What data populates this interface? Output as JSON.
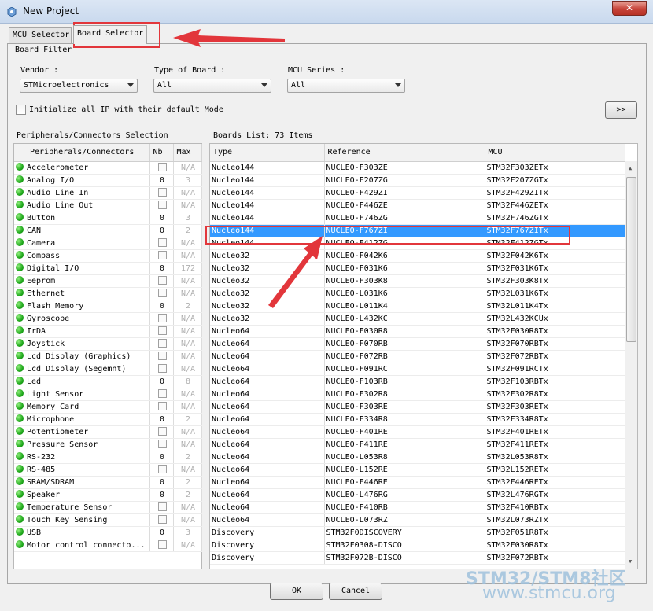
{
  "window": {
    "title": "New Project",
    "close_glyph": "✕"
  },
  "tabs": [
    {
      "label": "MCU Selector"
    },
    {
      "label": "Board Selector"
    }
  ],
  "board_filter": {
    "title": "Board Filter",
    "vendor_label": "Vendor :",
    "vendor_value": "STMicroelectronics",
    "type_label": "Type of Board :",
    "type_value": "All",
    "series_label": "MCU Series :",
    "series_value": "All",
    "init_ip_label": "Initialize all IP with their default Mode",
    "expand_label": ">>"
  },
  "peripherals": {
    "title": "Peripherals/Connectors Selection",
    "headers": [
      "Peripherals/Connectors",
      "Nb",
      "Max"
    ],
    "rows": [
      {
        "name": "Accelerometer",
        "nb": "",
        "max": "N/A"
      },
      {
        "name": "Analog I/O",
        "nb": "0",
        "max": "3"
      },
      {
        "name": "Audio Line In",
        "nb": "",
        "max": "N/A"
      },
      {
        "name": "Audio Line Out",
        "nb": "",
        "max": "N/A"
      },
      {
        "name": "Button",
        "nb": "0",
        "max": "3"
      },
      {
        "name": "CAN",
        "nb": "0",
        "max": "2"
      },
      {
        "name": "Camera",
        "nb": "",
        "max": "N/A"
      },
      {
        "name": "Compass",
        "nb": "",
        "max": "N/A"
      },
      {
        "name": "Digital I/O",
        "nb": "0",
        "max": "172"
      },
      {
        "name": "Eeprom",
        "nb": "",
        "max": "N/A"
      },
      {
        "name": "Ethernet",
        "nb": "",
        "max": "N/A"
      },
      {
        "name": "Flash Memory",
        "nb": "0",
        "max": "2"
      },
      {
        "name": "Gyroscope",
        "nb": "",
        "max": "N/A"
      },
      {
        "name": "IrDA",
        "nb": "",
        "max": "N/A"
      },
      {
        "name": "Joystick",
        "nb": "",
        "max": "N/A"
      },
      {
        "name": "Lcd Display (Graphics)",
        "nb": "",
        "max": "N/A"
      },
      {
        "name": "Lcd Display (Segemnt)",
        "nb": "",
        "max": "N/A"
      },
      {
        "name": "Led",
        "nb": "0",
        "max": "8"
      },
      {
        "name": "Light Sensor",
        "nb": "",
        "max": "N/A"
      },
      {
        "name": "Memory Card",
        "nb": "",
        "max": "N/A"
      },
      {
        "name": "Microphone",
        "nb": "0",
        "max": "2"
      },
      {
        "name": "Potentiometer",
        "nb": "",
        "max": "N/A"
      },
      {
        "name": "Pressure Sensor",
        "nb": "",
        "max": "N/A"
      },
      {
        "name": "RS-232",
        "nb": "0",
        "max": "2"
      },
      {
        "name": "RS-485",
        "nb": "",
        "max": "N/A"
      },
      {
        "name": "SRAM/SDRAM",
        "nb": "0",
        "max": "2"
      },
      {
        "name": "Speaker",
        "nb": "0",
        "max": "2"
      },
      {
        "name": "Temperature Sensor",
        "nb": "",
        "max": "N/A"
      },
      {
        "name": "Touch Key Sensing",
        "nb": "",
        "max": "N/A"
      },
      {
        "name": "USB",
        "nb": "0",
        "max": "3"
      },
      {
        "name": "Motor control connecto...",
        "nb": "",
        "max": "N/A"
      }
    ]
  },
  "boards": {
    "title": "Boards List: 73 Items",
    "headers": [
      "Type",
      "Reference",
      "MCU"
    ],
    "selected_index": 5,
    "rows": [
      {
        "type": "Nucleo144",
        "ref": "NUCLEO-F303ZE",
        "mcu": "STM32F303ZETx"
      },
      {
        "type": "Nucleo144",
        "ref": "NUCLEO-F207ZG",
        "mcu": "STM32F207ZGTx"
      },
      {
        "type": "Nucleo144",
        "ref": "NUCLEO-F429ZI",
        "mcu": "STM32F429ZITx"
      },
      {
        "type": "Nucleo144",
        "ref": "NUCLEO-F446ZE",
        "mcu": "STM32F446ZETx"
      },
      {
        "type": "Nucleo144",
        "ref": "NUCLEO-F746ZG",
        "mcu": "STM32F746ZGTx"
      },
      {
        "type": "Nucleo144",
        "ref": "NUCLEO-F767ZI",
        "mcu": "STM32F767ZITx"
      },
      {
        "type": "Nucleo144",
        "ref": "NUCLEO-F412ZG",
        "mcu": "STM32F412ZGTx"
      },
      {
        "type": "Nucleo32",
        "ref": "NUCLEO-F042K6",
        "mcu": "STM32F042K6Tx"
      },
      {
        "type": "Nucleo32",
        "ref": "NUCLEO-F031K6",
        "mcu": "STM32F031K6Tx"
      },
      {
        "type": "Nucleo32",
        "ref": "NUCLEO-F303K8",
        "mcu": "STM32F303K8Tx"
      },
      {
        "type": "Nucleo32",
        "ref": "NUCLEO-L031K6",
        "mcu": "STM32L031K6Tx"
      },
      {
        "type": "Nucleo32",
        "ref": "NUCLEO-L011K4",
        "mcu": "STM32L011K4Tx"
      },
      {
        "type": "Nucleo32",
        "ref": "NUCLEO-L432KC",
        "mcu": "STM32L432KCUx"
      },
      {
        "type": "Nucleo64",
        "ref": "NUCLEO-F030R8",
        "mcu": "STM32F030R8Tx"
      },
      {
        "type": "Nucleo64",
        "ref": "NUCLEO-F070RB",
        "mcu": "STM32F070RBTx"
      },
      {
        "type": "Nucleo64",
        "ref": "NUCLEO-F072RB",
        "mcu": "STM32F072RBTx"
      },
      {
        "type": "Nucleo64",
        "ref": "NUCLEO-F091RC",
        "mcu": "STM32F091RCTx"
      },
      {
        "type": "Nucleo64",
        "ref": "NUCLEO-F103RB",
        "mcu": "STM32F103RBTx"
      },
      {
        "type": "Nucleo64",
        "ref": "NUCLEO-F302R8",
        "mcu": "STM32F302R8Tx"
      },
      {
        "type": "Nucleo64",
        "ref": "NUCLEO-F303RE",
        "mcu": "STM32F303RETx"
      },
      {
        "type": "Nucleo64",
        "ref": "NUCLEO-F334R8",
        "mcu": "STM32F334R8Tx"
      },
      {
        "type": "Nucleo64",
        "ref": "NUCLEO-F401RE",
        "mcu": "STM32F401RETx"
      },
      {
        "type": "Nucleo64",
        "ref": "NUCLEO-F411RE",
        "mcu": "STM32F411RETx"
      },
      {
        "type": "Nucleo64",
        "ref": "NUCLEO-L053R8",
        "mcu": "STM32L053R8Tx"
      },
      {
        "type": "Nucleo64",
        "ref": "NUCLEO-L152RE",
        "mcu": "STM32L152RETx"
      },
      {
        "type": "Nucleo64",
        "ref": "NUCLEO-F446RE",
        "mcu": "STM32F446RETx"
      },
      {
        "type": "Nucleo64",
        "ref": "NUCLEO-L476RG",
        "mcu": "STM32L476RGTx"
      },
      {
        "type": "Nucleo64",
        "ref": "NUCLEO-F410RB",
        "mcu": "STM32F410RBTx"
      },
      {
        "type": "Nucleo64",
        "ref": "NUCLEO-L073RZ",
        "mcu": "STM32L073RZTx"
      },
      {
        "type": "Discovery",
        "ref": "STM32F0DISCOVERY",
        "mcu": "STM32F051R8Tx"
      },
      {
        "type": "Discovery",
        "ref": "STM32F0308-DISCO",
        "mcu": "STM32F030R8Tx"
      },
      {
        "type": "Discovery",
        "ref": "STM32F072B-DISCO",
        "mcu": "STM32F072RBTx"
      }
    ]
  },
  "buttons": {
    "ok": "OK",
    "cancel": "Cancel"
  },
  "watermark": {
    "line1": "STM32/STM8社区",
    "line2": "www.stmcu.org"
  },
  "colors": {
    "selection": "#3399ff",
    "annotation": "#e2363b",
    "status_dot": "#1fa81b"
  }
}
